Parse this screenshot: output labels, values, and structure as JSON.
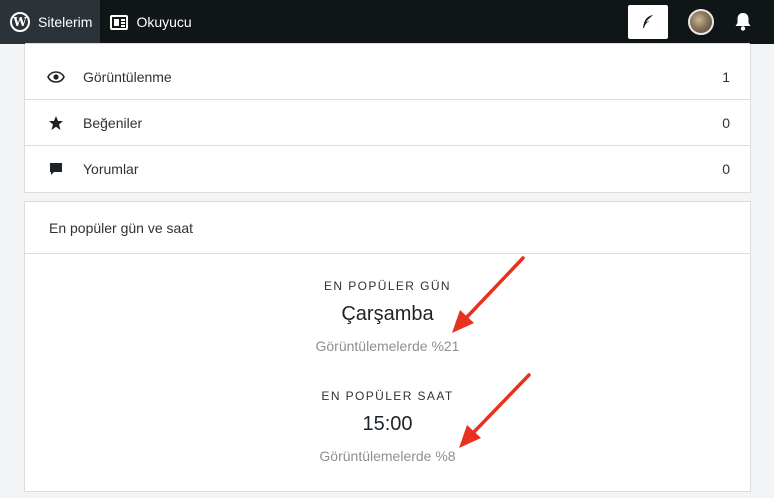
{
  "topbar": {
    "my_sites": "Sitelerim",
    "reader": "Okuyucu",
    "icons": [
      "wordpress-icon",
      "reader-icon",
      "write-icon",
      "avatar",
      "bell-icon"
    ]
  },
  "stats": [
    {
      "icon": "eye-icon",
      "label": "Görüntülenme",
      "value": "1"
    },
    {
      "icon": "star-icon",
      "label": "Beğeniler",
      "value": "0"
    },
    {
      "icon": "comment-icon",
      "label": "Yorumlar",
      "value": "0"
    }
  ],
  "popular": {
    "heading": "En popüler gün ve saat",
    "day": {
      "title": "EN POPÜLER GÜN",
      "value": "Çarşamba",
      "sub": "Görüntülemelerde %21"
    },
    "hour": {
      "title": "EN POPÜLER SAAT",
      "value": "15:00",
      "sub": "Görüntülemelerde %8"
    }
  },
  "colors": {
    "topbar": "#101517",
    "active": "#2c3338",
    "arrow": "#e8321f"
  }
}
